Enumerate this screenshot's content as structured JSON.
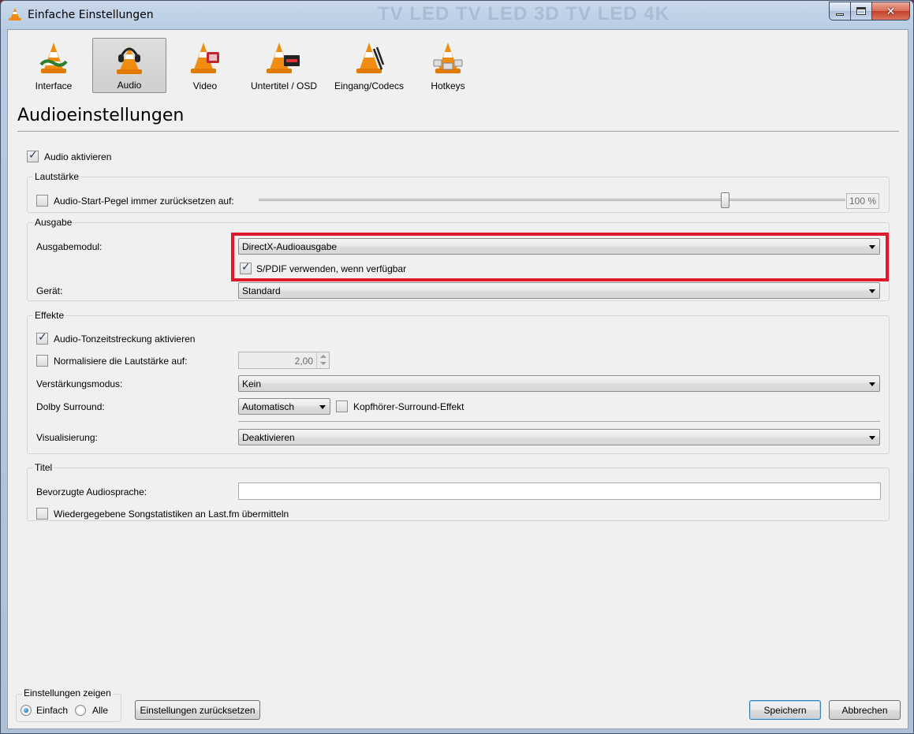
{
  "window": {
    "title": "Einfache Einstellungen",
    "background_text": "TV LED TV LED 3D TV LED 4K"
  },
  "categories": [
    {
      "label": "Interface",
      "icon": "vlc-cone-icon"
    },
    {
      "label": "Audio",
      "icon": "vlc-headphones-icon",
      "selected": true
    },
    {
      "label": "Video",
      "icon": "vlc-video-icon"
    },
    {
      "label": "Untertitel / OSD",
      "icon": "vlc-subtitles-icon"
    },
    {
      "label": "Eingang/Codecs",
      "icon": "vlc-codecs-icon"
    },
    {
      "label": "Hotkeys",
      "icon": "vlc-hotkeys-icon"
    }
  ],
  "page": {
    "title": "Audioeinstellungen",
    "enable_audio": {
      "label": "Audio aktivieren",
      "checked": true
    }
  },
  "volume": {
    "group_title": "Lautstärke",
    "reset_label": "Audio-Start-Pegel immer zurücksetzen auf:",
    "reset_checked": false,
    "level_percent": 100,
    "level_text": "100 %"
  },
  "output": {
    "group_title": "Ausgabe",
    "module_label": "Ausgabemodul:",
    "module_value": "DirectX-Audioausgabe",
    "spdif_label": "S/PDIF verwenden, wenn verfügbar",
    "spdif_checked": true,
    "device_label": "Gerät:",
    "device_value": "Standard"
  },
  "effects": {
    "group_title": "Effekte",
    "timestretch_label": "Audio-Tonzeitstreckung aktivieren",
    "timestretch_checked": true,
    "normalize_label": "Normalisiere die Lautstärke auf:",
    "normalize_checked": false,
    "normalize_value": "2,00",
    "gain_label": "Verstärkungsmodus:",
    "gain_value": "Kein",
    "dolby_label": "Dolby Surround:",
    "dolby_value": "Automatisch",
    "headphone_label": "Kopfhörer-Surround-Effekt",
    "headphone_checked": false,
    "visualization_label": "Visualisierung:",
    "visualization_value": "Deaktivieren"
  },
  "titles": {
    "group_title": "Titel",
    "language_label": "Bevorzugte Audiosprache:",
    "language_value": "",
    "lastfm_label": "Wiedergegebene Songstatistiken an Last.fm übermitteln",
    "lastfm_checked": false
  },
  "footer": {
    "show_settings_title": "Einstellungen zeigen",
    "simple_label": "Einfach",
    "all_label": "Alle",
    "mode": "Einfach",
    "reset_button": "Einstellungen zurücksetzen",
    "save_button": "Speichern",
    "cancel_button": "Abbrechen"
  },
  "colors": {
    "highlight": "#e0182c",
    "vlc_orange": "#f08c10"
  }
}
